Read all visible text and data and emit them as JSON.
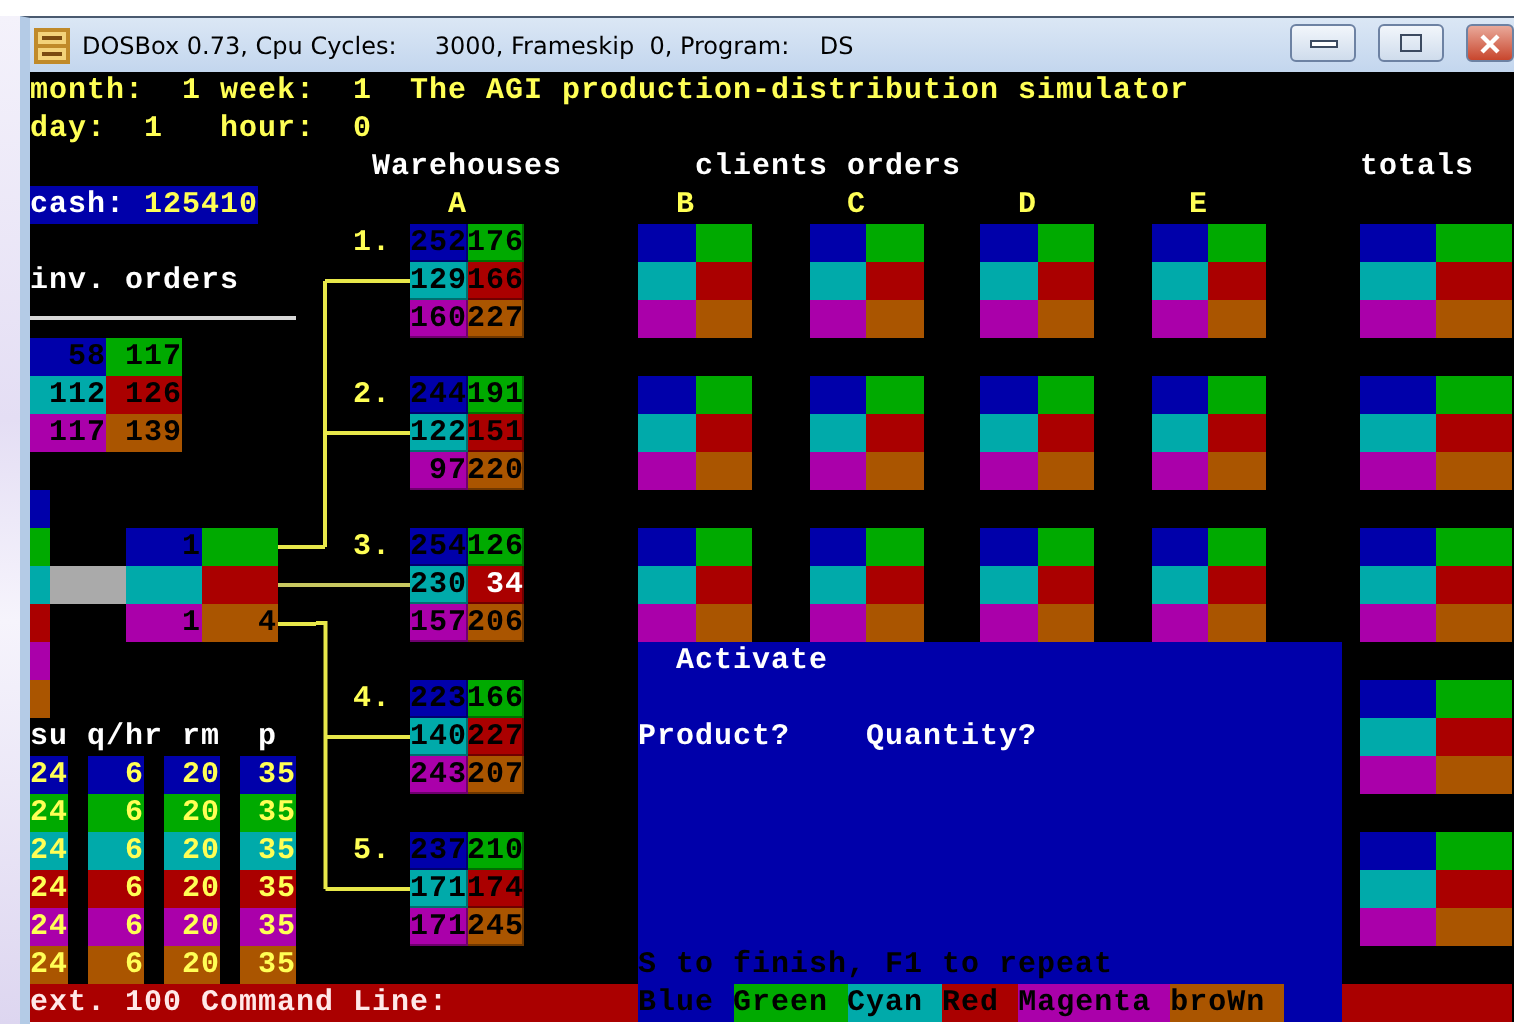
{
  "window": {
    "title": "DOSBox 0.73, Cpu Cycles:     3000, Frameskip  0, Program:    DS"
  },
  "header": {
    "month_label": "month:",
    "month": "1",
    "week_label": "week:",
    "week": "1",
    "title": "The AGI production-distribution simulator",
    "day_label": "day:",
    "day": "1",
    "hour_label": "hour:",
    "hour": "0"
  },
  "cash": {
    "label": "cash:",
    "value": "125410"
  },
  "inventory_orders": {
    "title": "inv. orders",
    "values": [
      "58",
      "117",
      "112",
      "126",
      "117",
      "139"
    ]
  },
  "production": {
    "cells": [
      {
        "value": "1",
        "empty": false
      },
      {
        "empty": true
      },
      {
        "empty": true
      },
      {
        "empty": true
      },
      {
        "value": "1",
        "empty": false
      },
      {
        "value": "4",
        "empty": false
      }
    ]
  },
  "rates": {
    "columns": [
      "su",
      "q/hr",
      "rm",
      "p"
    ],
    "rows": [
      [
        "24",
        "6",
        "20",
        "35"
      ],
      [
        "24",
        "6",
        "20",
        "35"
      ],
      [
        "24",
        "6",
        "20",
        "35"
      ],
      [
        "24",
        "6",
        "20",
        "35"
      ],
      [
        "24",
        "6",
        "20",
        "35"
      ],
      [
        "24",
        "6",
        "20",
        "35"
      ]
    ]
  },
  "warehouses": {
    "title": "Warehouses",
    "column_label": "A",
    "items": [
      {
        "number": "1.",
        "stock": [
          {
            "value": "252",
            "alert": false
          },
          {
            "value": "176",
            "alert": false
          },
          {
            "value": "129",
            "alert": false
          },
          {
            "value": "166",
            "alert": false
          },
          {
            "value": "160",
            "alert": false
          },
          {
            "value": "227",
            "alert": false
          }
        ]
      },
      {
        "number": "2.",
        "stock": [
          {
            "value": "244",
            "alert": false
          },
          {
            "value": "191",
            "alert": false
          },
          {
            "value": "122",
            "alert": false
          },
          {
            "value": "151",
            "alert": false
          },
          {
            "value": "97",
            "alert": false
          },
          {
            "value": "220",
            "alert": false
          }
        ]
      },
      {
        "number": "3.",
        "stock": [
          {
            "value": "254",
            "alert": false
          },
          {
            "value": "126",
            "alert": false
          },
          {
            "value": "230",
            "alert": false
          },
          {
            "value": "34",
            "alert": true
          },
          {
            "value": "157",
            "alert": false
          },
          {
            "value": "206",
            "alert": false
          }
        ]
      },
      {
        "number": "4.",
        "stock": [
          {
            "value": "223",
            "alert": false
          },
          {
            "value": "166",
            "alert": false
          },
          {
            "value": "140",
            "alert": false
          },
          {
            "value": "227",
            "alert": false
          },
          {
            "value": "243",
            "alert": false
          },
          {
            "value": "207",
            "alert": false
          }
        ]
      },
      {
        "number": "5.",
        "stock": [
          {
            "value": "237",
            "alert": false
          },
          {
            "value": "210",
            "alert": false
          },
          {
            "value": "171",
            "alert": false
          },
          {
            "value": "174",
            "alert": false
          },
          {
            "value": "171",
            "alert": false
          },
          {
            "value": "245",
            "alert": false
          }
        ]
      }
    ]
  },
  "clients": {
    "title": "clients orders",
    "items": [
      {
        "label": "B"
      },
      {
        "label": "C"
      },
      {
        "label": "D"
      },
      {
        "label": "E"
      }
    ]
  },
  "totals": {
    "title": "totals"
  },
  "dialog": {
    "title": "Activate",
    "prompts": [
      "Product?",
      "Quantity?"
    ],
    "hint": "S to finish, F1 to repeat"
  },
  "status_bar": {
    "command_label": "ext. 100 Command Line:"
  },
  "legend": [
    {
      "label": "Blue",
      "color": "#0000aa"
    },
    {
      "label": "Green",
      "color": "#00aa00"
    },
    {
      "label": "Cyan",
      "color": "#00aaaa"
    },
    {
      "label": "Red",
      "color": "#aa0000"
    },
    {
      "label": "Magenta",
      "color": "#aa00aa"
    },
    {
      "label": "broWn",
      "color": "#aa5500"
    }
  ]
}
